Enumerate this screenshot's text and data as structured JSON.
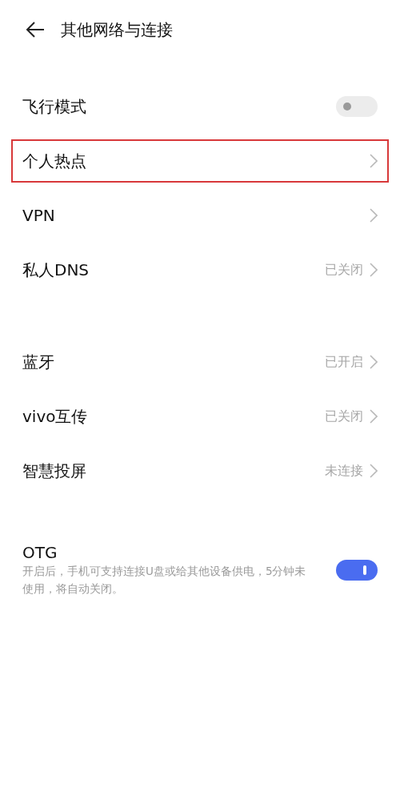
{
  "header": {
    "title": "其他网络与连接"
  },
  "sections": [
    {
      "items": [
        {
          "kind": "toggle",
          "label": "飞行模式",
          "on": false,
          "highlighted": false
        },
        {
          "kind": "link",
          "label": "个人热点",
          "highlighted": true
        },
        {
          "kind": "link",
          "label": "VPN",
          "highlighted": false
        },
        {
          "kind": "link",
          "label": "私人DNS",
          "value": "已关闭",
          "highlighted": false
        }
      ]
    },
    {
      "items": [
        {
          "kind": "link",
          "label": "蓝牙",
          "value": "已开启",
          "highlighted": false
        },
        {
          "kind": "link",
          "label": "vivo互传",
          "value": "已关闭",
          "highlighted": false
        },
        {
          "kind": "link",
          "label": "智慧投屏",
          "value": "未连接",
          "highlighted": false
        }
      ]
    },
    {
      "items": [
        {
          "kind": "toggle",
          "label": "OTG",
          "description": "开启后，手机可支持连接U盘或给其他设备供电，5分钟未使用，将自动关闭。",
          "on": true,
          "highlighted": false
        }
      ]
    }
  ]
}
